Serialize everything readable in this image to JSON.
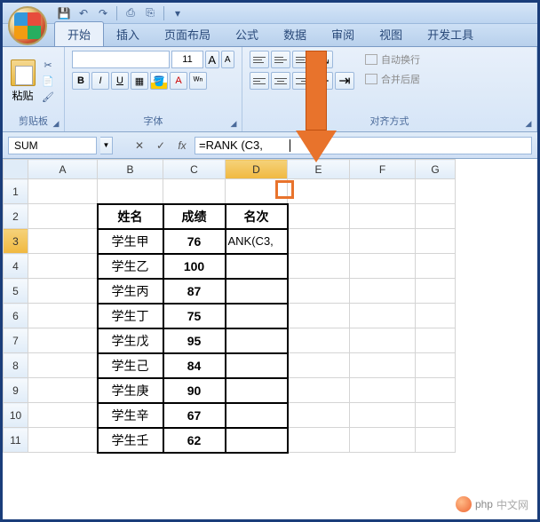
{
  "qat": {
    "save": "💾",
    "undo": "↶",
    "redo": "↷",
    "print": "⎙",
    "quick": "⎘",
    "down": "▾"
  },
  "tabs": [
    "开始",
    "插入",
    "页面布局",
    "公式",
    "数据",
    "审阅",
    "视图",
    "开发工具"
  ],
  "ribbon": {
    "clipboard": {
      "paste": "粘贴",
      "title": "剪贴板"
    },
    "font": {
      "size": "11",
      "biggerA": "A",
      "smallerA": "A",
      "title": "字体",
      "bold": "B",
      "italic": "I",
      "under": "U"
    },
    "align": {
      "title": "对齐方式",
      "wrap": "自动换行",
      "merge": "合并后居"
    }
  },
  "formulabar": {
    "namebox": "SUM",
    "cancel": "✕",
    "enter": "✓",
    "fx": "fx",
    "formula": "=RANK (C3,"
  },
  "columns": [
    "A",
    "B",
    "C",
    "D",
    "E",
    "F",
    "G"
  ],
  "rows": [
    "1",
    "2",
    "3",
    "4",
    "5",
    "6",
    "7",
    "8",
    "9",
    "10",
    "11"
  ],
  "active": {
    "row": 3,
    "col": "D",
    "display": "ANK(C3,"
  },
  "chart_data": {
    "type": "table",
    "headers": [
      "姓名",
      "成绩",
      "名次"
    ],
    "rows": [
      {
        "name": "学生甲",
        "score": 76
      },
      {
        "name": "学生乙",
        "score": 100
      },
      {
        "name": "学生丙",
        "score": 87
      },
      {
        "name": "学生丁",
        "score": 75
      },
      {
        "name": "学生戊",
        "score": 95
      },
      {
        "name": "学生己",
        "score": 84
      },
      {
        "name": "学生庚",
        "score": 90
      },
      {
        "name": "学生辛",
        "score": 67
      },
      {
        "name": "学生壬",
        "score": 62
      }
    ]
  },
  "watermark": "中文网",
  "watermark_prefix": "php"
}
